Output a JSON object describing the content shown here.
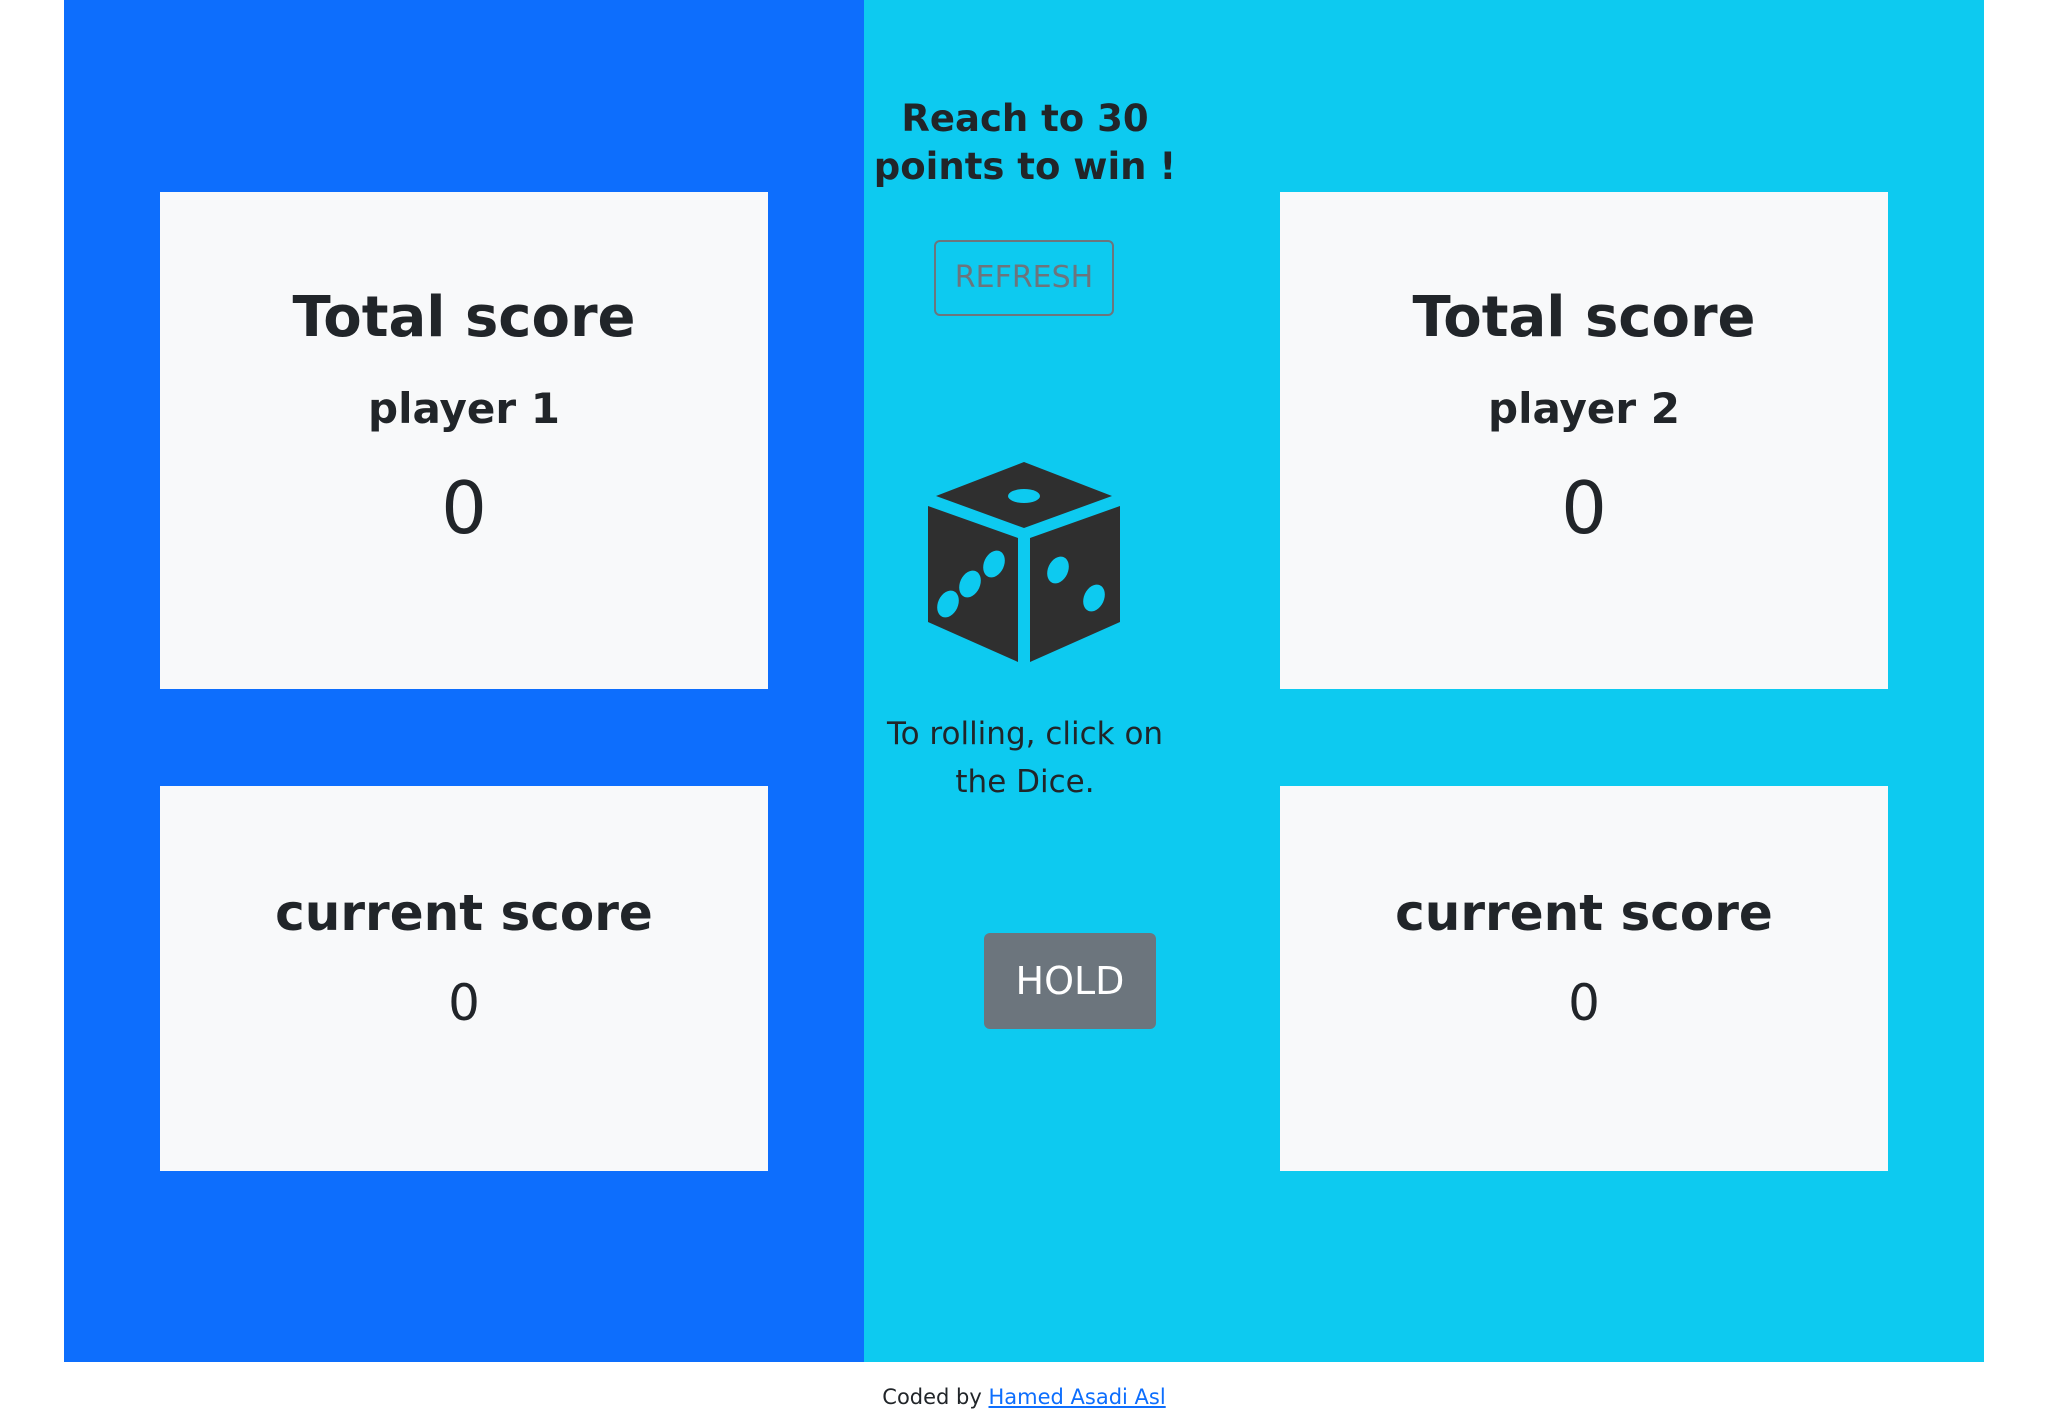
{
  "game": {
    "goal_text": "Reach to 30 points to win !",
    "refresh_label": "REFRESH",
    "dice_icon": "dice-icon",
    "hint_text": "To rolling, click on the Dice.",
    "hold_label": "HOLD"
  },
  "players": [
    {
      "total_title": "Total score",
      "name": "player 1",
      "total_value": "0",
      "current_title": "current score",
      "current_value": "0"
    },
    {
      "total_title": "Total score",
      "name": "player 2",
      "total_value": "0",
      "current_title": "current score",
      "current_value": "0"
    }
  ],
  "footer": {
    "prefix": "Coded by",
    "author": "Hamed Asadi Asl"
  },
  "colors": {
    "player1_bg": "#0d6efd",
    "player2_bg": "#0dcaf0",
    "card_bg": "#f8f9fa",
    "button_secondary": "#6c757d",
    "dice_body": "#2f2f2f"
  }
}
